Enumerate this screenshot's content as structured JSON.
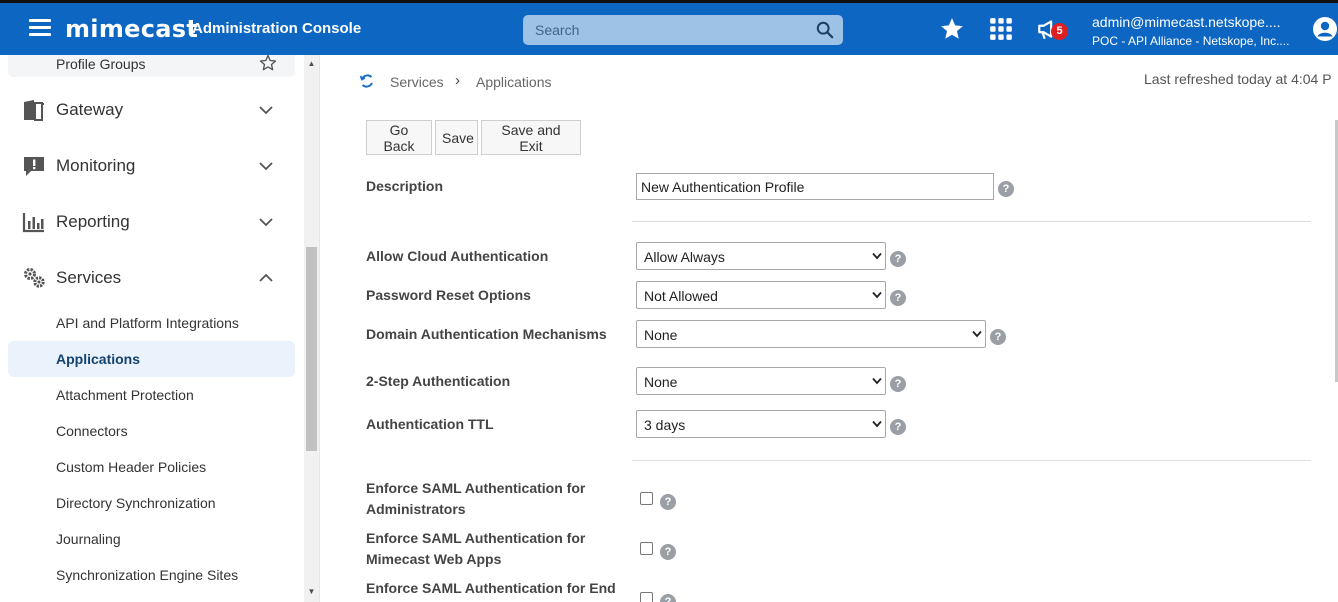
{
  "header": {
    "logo_text": "mimecast",
    "console_title": "Administration Console",
    "search_placeholder": "Search",
    "notification_count": "5",
    "user_email": "admin@mimecast.netskope....",
    "user_account": "POC - API Alliance - Netskope, Inc....",
    "colors": {
      "bar": "#0c66c2",
      "badge": "#e02020"
    }
  },
  "sidebar": {
    "top_item": {
      "label": "Profile Groups",
      "icon": "star-outline-icon"
    },
    "sections": [
      {
        "label": "Gateway",
        "icon": "gateway-icon",
        "expanded": false
      },
      {
        "label": "Monitoring",
        "icon": "monitoring-icon",
        "expanded": false
      },
      {
        "label": "Reporting",
        "icon": "reporting-icon",
        "expanded": false
      },
      {
        "label": "Services",
        "icon": "gears-icon",
        "expanded": true
      }
    ],
    "services_items": [
      {
        "label": "API and Platform Integrations",
        "active": false
      },
      {
        "label": "Applications",
        "active": true
      },
      {
        "label": "Attachment Protection",
        "active": false
      },
      {
        "label": "Connectors",
        "active": false
      },
      {
        "label": "Custom Header Policies",
        "active": false
      },
      {
        "label": "Directory Synchronization",
        "active": false
      },
      {
        "label": "Journaling",
        "active": false
      },
      {
        "label": "Synchronization Engine Sites",
        "active": false
      }
    ]
  },
  "main": {
    "breadcrumb": [
      "Services",
      "Applications"
    ],
    "last_refreshed": "Last refreshed today at 4:04 P",
    "buttons": {
      "go_back": "Go Back",
      "save": "Save",
      "save_exit": "Save and Exit"
    },
    "description": {
      "label": "Description",
      "value": "New Authentication Profile"
    },
    "fields": {
      "allow_cloud_auth": {
        "label": "Allow Cloud Authentication",
        "value": "Allow Always"
      },
      "password_reset": {
        "label": "Password Reset Options",
        "value": "Not Allowed"
      },
      "domain_auth": {
        "label": "Domain Authentication Mechanisms",
        "value": "None"
      },
      "two_step": {
        "label": "2-Step Authentication",
        "value": "None"
      },
      "auth_ttl": {
        "label": "Authentication TTL",
        "value": "3 days"
      }
    },
    "saml": {
      "admins": {
        "line1": "Enforce SAML Authentication for",
        "line2": "Administrators",
        "checked": false
      },
      "web_apps": {
        "line1": "Enforce SAML Authentication for",
        "line2": "Mimecast Web Apps",
        "checked": false
      },
      "end_users": {
        "line1": "Enforce SAML Authentication for End",
        "checked": false
      }
    },
    "help_glyph": "?"
  }
}
